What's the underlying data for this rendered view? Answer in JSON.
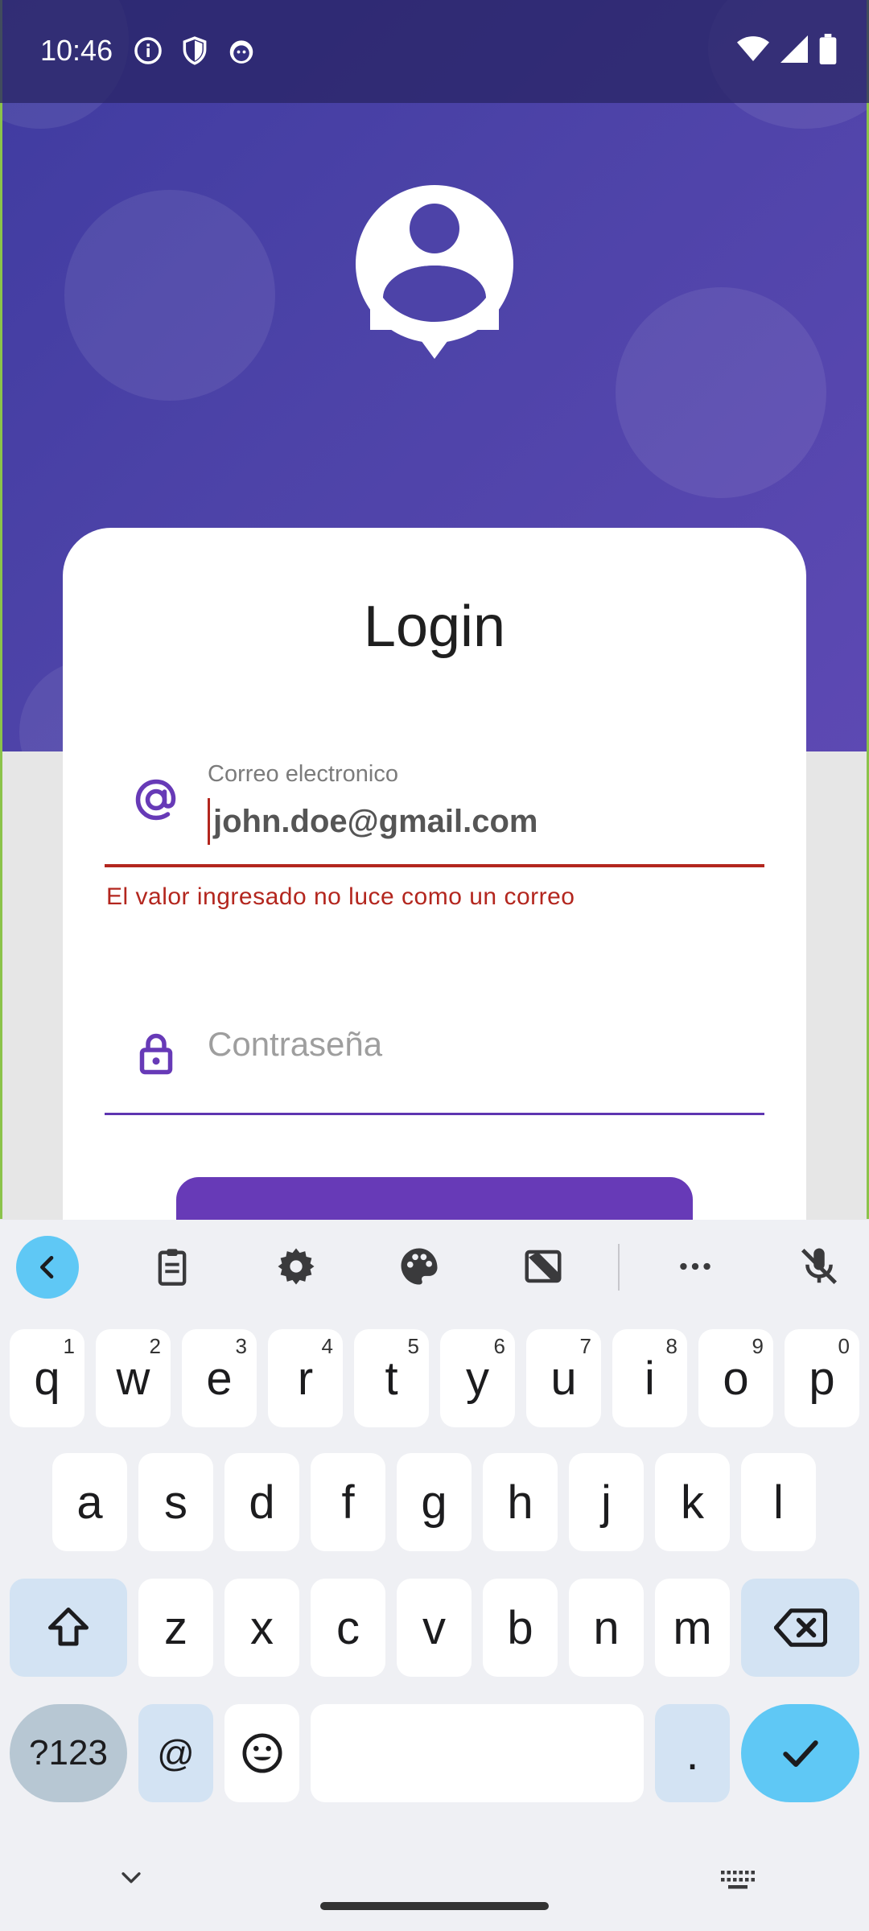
{
  "status_bar": {
    "time": "10:46",
    "left_icons": [
      "info-icon",
      "shield-icon",
      "android-icon"
    ],
    "right_icons": [
      "wifi-icon",
      "signal-icon",
      "battery-icon"
    ]
  },
  "colors": {
    "header_purple": "#4d43a8",
    "primary": "#673ab7",
    "error": "#b3261e",
    "keyboard_accent": "#5fc8f5"
  },
  "login": {
    "title": "Login",
    "email": {
      "label": "Correo electronico",
      "value": "john.doe@gmail.com",
      "error": "El valor ingresado no luce como un correo",
      "icon": "at-sign-icon"
    },
    "password": {
      "placeholder": "Contraseña",
      "icon": "lock-icon"
    }
  },
  "keyboard": {
    "toolbar": [
      "back-icon",
      "clipboard-icon",
      "gear-icon",
      "palette-icon",
      "resize-icon",
      "more-icon",
      "mic-off-icon"
    ],
    "row1": [
      {
        "key": "q",
        "hint": "1"
      },
      {
        "key": "w",
        "hint": "2"
      },
      {
        "key": "e",
        "hint": "3"
      },
      {
        "key": "r",
        "hint": "4"
      },
      {
        "key": "t",
        "hint": "5"
      },
      {
        "key": "y",
        "hint": "6"
      },
      {
        "key": "u",
        "hint": "7"
      },
      {
        "key": "i",
        "hint": "8"
      },
      {
        "key": "o",
        "hint": "9"
      },
      {
        "key": "p",
        "hint": "0"
      }
    ],
    "row2": [
      "a",
      "s",
      "d",
      "f",
      "g",
      "h",
      "j",
      "k",
      "l"
    ],
    "row3": [
      "z",
      "x",
      "c",
      "v",
      "b",
      "n",
      "m"
    ],
    "bottom": {
      "symbols": "?123",
      "at": "@",
      "dot": "."
    }
  }
}
